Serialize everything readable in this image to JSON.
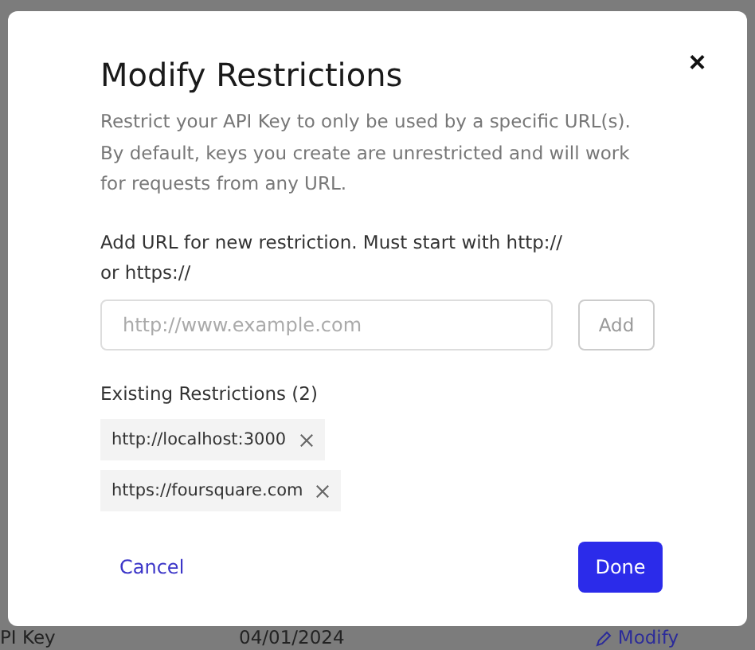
{
  "dialog": {
    "title": "Modify Restrictions",
    "close": "×",
    "description": "Restrict your API Key to only be used by a specific URL(s). By default, keys you create are unrestricted and will work for requests from any URL.",
    "url_label": "Add URL for new restriction. Must start with http:// or https://",
    "url_field": {
      "placeholder": "http://www.example.com"
    },
    "add_button": {
      "label": "Add",
      "disabled": true
    },
    "existing_label": "Existing Restrictions (2)",
    "restrictions": [
      {
        "url": "http://localhost:3000"
      },
      {
        "url": "https://foursquare.com"
      }
    ],
    "cancel": "Cancel",
    "done": "Done"
  },
  "background_row": {
    "name": "PI Key",
    "date": "04/01/2024",
    "action": "Modify"
  }
}
